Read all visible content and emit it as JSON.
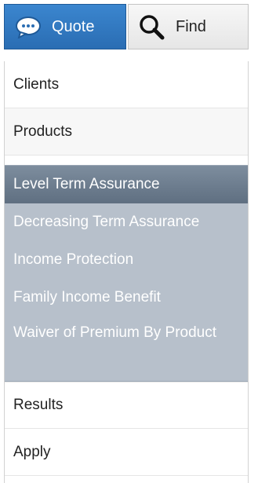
{
  "tabs": {
    "quote": {
      "label": "Quote",
      "icon": "chat-bubble-icon",
      "active": true
    },
    "find": {
      "label": "Find",
      "icon": "magnifier-icon",
      "active": false
    }
  },
  "menu": {
    "clients": "Clients",
    "products": "Products",
    "submenu": [
      "Level Term Assurance",
      "Decreasing Term Assurance",
      "Income Protection",
      "Family Income Benefit",
      "Waiver of Premium By Product"
    ],
    "results": "Results",
    "apply": "Apply"
  },
  "colors": {
    "tab_active": "#2f78c2",
    "submenu_bg": "#b7c0cb",
    "submenu_selected": "#6e7e90"
  }
}
